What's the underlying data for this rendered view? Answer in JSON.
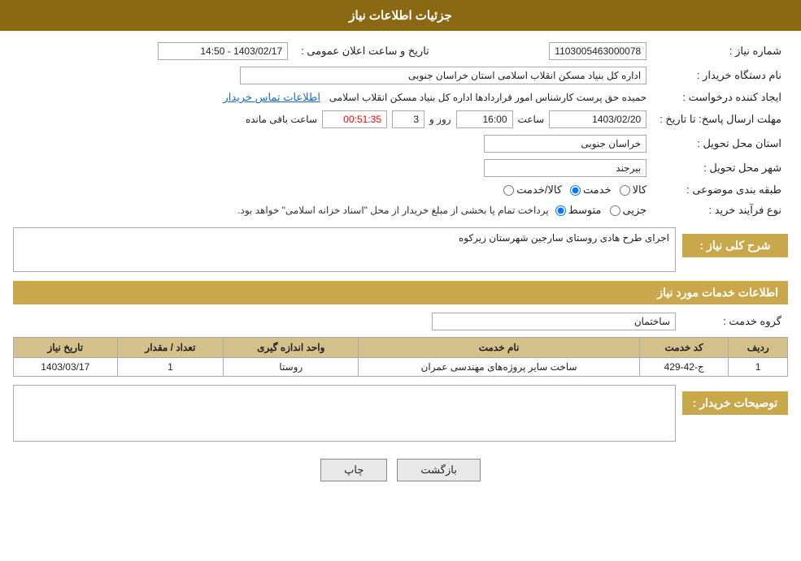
{
  "header": {
    "title": "جزئیات اطلاعات نیاز"
  },
  "fields": {
    "shomare_niaz_label": "شماره نیاز :",
    "shomare_niaz_value": "1103005463000078",
    "name_dasgah_label": "نام دستگاه خریدار :",
    "name_dasgah_value": "اداره کل بنیاد مسکن انقلاب اسلامی استان خراسان جنوبی",
    "ijad_konande_label": "ایجاد کننده درخواست :",
    "ijad_konande_value": "حمیده حق پرست کارشناس امور قراردادها اداره کل بنیاد مسکن انقلاب اسلامی",
    "ijad_konande_link": "اطلاعات تماس خریدار",
    "mohlat_label": "مهلت ارسال پاسخ: تا تاریخ :",
    "tarikh_value": "1403/02/20",
    "saat_label": "ساعت",
    "saat_value": "16:00",
    "rooz_label": "روز و",
    "rooz_value": "3",
    "baghimande_value": "00:51:35",
    "baghimande_label": "ساعت باقی مانده",
    "tarikh_aalan_label": "تاریخ و ساعت اعلان عمومی :",
    "tarikh_aalan_value": "1403/02/17 - 14:50",
    "ostan_tahvil_label": "استان محل تحویل :",
    "ostan_tahvil_value": "خراسان جنوبی",
    "shahr_tahvil_label": "شهر محل تحویل :",
    "shahr_tahvil_value": "بیرجند",
    "tabaqe_label": "طبقه بندی موضوعی :",
    "tabaqe_options": [
      {
        "id": "kala",
        "label": "کالا"
      },
      {
        "id": "khadamat",
        "label": "خدمت"
      },
      {
        "id": "kala_khadamat",
        "label": "کالا/خدمت"
      }
    ],
    "tabaqe_selected": "khadamat",
    "feraiand_label": "نوع فرآیند خرید :",
    "feraind_options": [
      {
        "id": "jozii",
        "label": "جزیی"
      },
      {
        "id": "motavaset",
        "label": "متوسط"
      }
    ],
    "feraind_selected": "motavaset",
    "feraind_note": "پرداخت تمام یا بخشی از مبلغ خریدار از محل \"اسناد خزانه اسلامی\" خواهد بود.",
    "sharh_niaz_label": "شرح کلی نیاز :",
    "sharh_niaz_value": "اجرای طرح هادی روستای سارجین شهرستان زیرکوه",
    "service_info_label": "اطلاعات خدمات مورد نیاز",
    "group_khadamat_label": "گروه خدمت :",
    "group_khadamat_value": "ساختمان",
    "table_headers": [
      "ردیف",
      "کد خدمت",
      "نام خدمت",
      "واحد اندازه گیری",
      "تعداد / مقدار",
      "تاریخ نیاز"
    ],
    "table_rows": [
      {
        "radif": "1",
        "kod_khadamat": "ج-42-429",
        "name_khadamat": "ساخت سایر پروژه‌های مهندسی عمران",
        "vahed": "روستا",
        "tedad": "1",
        "tarikh": "1403/03/17"
      }
    ],
    "toseef_label": "توصیحات خریدار :",
    "toseef_value": "",
    "btn_print": "چاپ",
    "btn_back": "بازگشت"
  }
}
